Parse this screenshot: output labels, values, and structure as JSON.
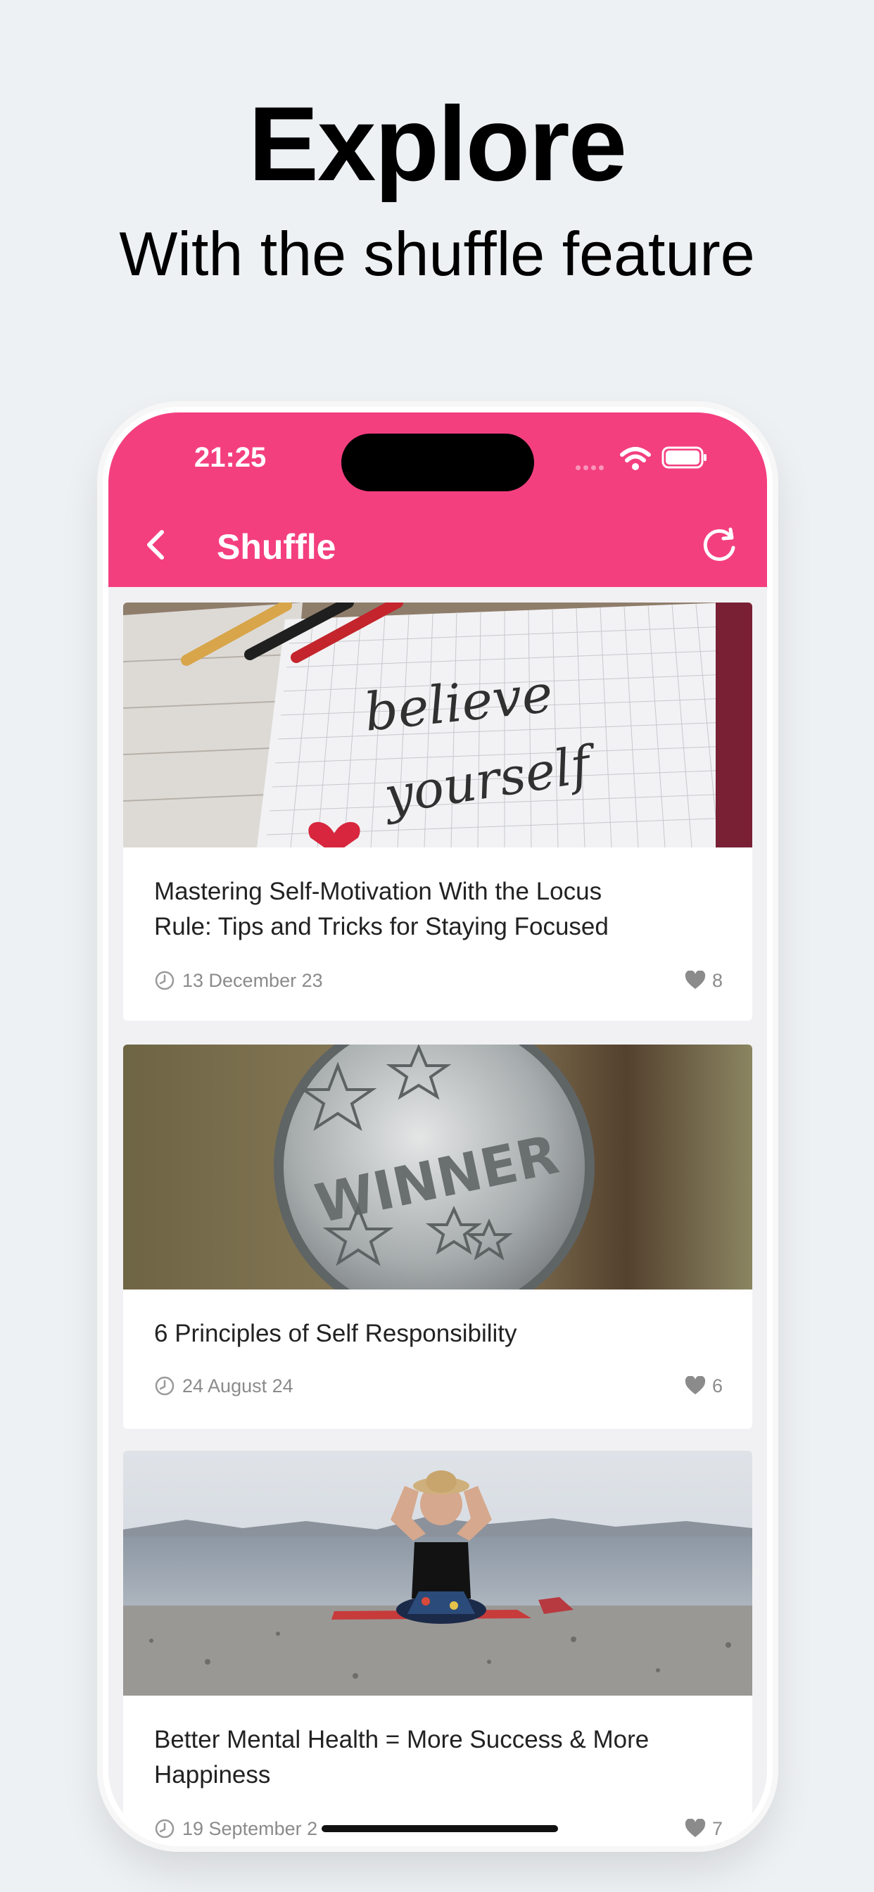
{
  "hero": {
    "title": "Explore",
    "subtitle": "With the shuffle feature"
  },
  "status_bar": {
    "time": "21:25",
    "icons": [
      "wifi-icon",
      "battery-icon"
    ]
  },
  "navbar": {
    "title": "Shuffle",
    "back_icon": "chevron-left-icon",
    "refresh_icon": "refresh-icon",
    "color": "#f43f7f"
  },
  "articles": [
    {
      "title_line1": "Mastering Self-Motivation With the Locus",
      "title_line2": "Rule: Tips and Tricks for Staying Focused",
      "date": "13 December 23",
      "likes": "8",
      "image": "notebook-believe-yourself-image"
    },
    {
      "title_line1": "6 Principles of Self Responsibility",
      "title_line2": "",
      "date": "24 August 24",
      "likes": "6",
      "image": "winner-coin-image"
    },
    {
      "title_line1": "Better Mental Health = More Success & More",
      "title_line2": "Happiness",
      "date": "19 September 2",
      "likes": "7",
      "image": "beach-meditation-image"
    }
  ],
  "images": {
    "notebook_handwriting_line1": "believe",
    "notebook_handwriting_line2": "yourself",
    "coin_text": "WINNER"
  }
}
